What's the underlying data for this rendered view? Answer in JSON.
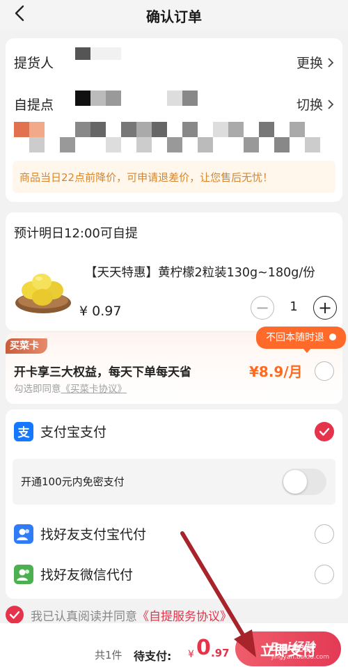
{
  "header": {
    "title": "确认订单"
  },
  "pickup": {
    "person_label": "提货人",
    "person_action": "更换",
    "point_label": "自提点",
    "point_action": "切换",
    "promo": "商品当日22点前降价，可申请退差价，让您售后无忧！"
  },
  "order": {
    "eta": "预计明日12:00可自提",
    "product_name": "【天天特惠】黄柠檬2粒装130g~180g/份",
    "price": "¥ 0.97",
    "quantity": "1",
    "minus": "−",
    "plus": "+"
  },
  "vip": {
    "badge": "买菜卡",
    "tag": "不回本随时退",
    "title": "开卡享三大权益，每天下单每天省",
    "price": "¥8.9/月",
    "agree_prefix": "勾选即同意",
    "agree_link": "《买菜卡协议》"
  },
  "payment": {
    "alipay": "支付宝支付",
    "nopass": "开通100元内免密支付",
    "friend_alipay": "找好友支付宝代付",
    "friend_wechat": "找好友微信代付"
  },
  "agreement": {
    "text": "我已认真阅读并同意",
    "link": "《自提服务协议》"
  },
  "footer": {
    "count": "共1件",
    "label": "待支付:",
    "currency": "¥",
    "amount_int": "0",
    "amount_dec": ".97",
    "button": "立即支付",
    "watermark": "Bai经验",
    "watermark_sub": "jingyan.baidu.com"
  },
  "colors": {
    "accent": "#e5334b",
    "orange": "#ff6a1f",
    "promo_text": "#d7862e",
    "alipay": "#1677ff",
    "wechat": "#4caf50",
    "arrow": "#a8242b"
  }
}
